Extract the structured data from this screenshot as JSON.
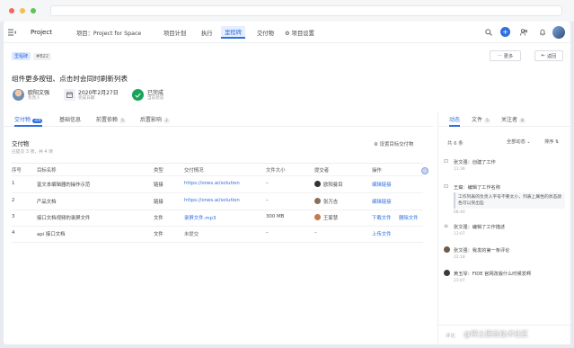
{
  "colors": {
    "accent": "#2f6fe0",
    "success": "#1aa35a"
  },
  "nav": {
    "menu_icon": "menu-collapse-icon",
    "project": "Project",
    "tabs": [
      "项目：Project for Space",
      "项目计划",
      "执行",
      "里程碑",
      "交付物",
      "项目设置"
    ],
    "active_tab": "里程碑"
  },
  "header": {
    "tag": "里程碑",
    "code": "#B22",
    "more": "更多",
    "back": "返回",
    "title": "组件更多按钮、点击时会同时刷新列表",
    "owner_name": "欧阳文强",
    "owner_label": "负责人",
    "date": "2020年2月27日",
    "date_label": "完成日期",
    "status": "已完成",
    "status_label": "当前状态"
  },
  "tabs": [
    {
      "label": "交付物",
      "count": "3/4"
    },
    {
      "label": "基础信息",
      "count": ""
    },
    {
      "label": "前置依赖",
      "count": "5"
    },
    {
      "label": "后置影响",
      "count": "2"
    }
  ],
  "deliverables": {
    "title": "交付物",
    "subtitle": "已提交 3 项，共 4 项",
    "settings": "设置目标交付物",
    "columns": [
      "序号",
      "目标名称",
      "类型",
      "交付情况",
      "文件大小",
      "提交者",
      "操作"
    ],
    "rows": [
      {
        "no": "1",
        "name": "富文本编辑器的操作示范",
        "type": "链接",
        "delivery": "https://ones.ai/solution",
        "size": "–",
        "submitter": "欧阳曼目",
        "actions": [
          "编辑链接"
        ]
      },
      {
        "no": "2",
        "name": "产品文档",
        "type": "链接",
        "delivery": "https://ones.ai/solution",
        "size": "–",
        "submitter": "张万吉",
        "actions": [
          "编辑链接"
        ]
      },
      {
        "no": "3",
        "name": "接口文档视频的录屏文件",
        "type": "文件",
        "delivery": "录屏文件.mp3",
        "size": "300 MB",
        "submitter": "王家慧",
        "actions": [
          "下载文件",
          "删除文件"
        ]
      },
      {
        "no": "4",
        "name": "api 接口文档",
        "type": "文件",
        "delivery": "未提交",
        "size": "–",
        "submitter": "–",
        "actions": [
          "上传文件"
        ]
      }
    ]
  },
  "activity": {
    "tabs": [
      {
        "label": "动态",
        "count": ""
      },
      {
        "label": "文件",
        "count": "5"
      },
      {
        "label": "关注者",
        "count": "8"
      }
    ],
    "total": "共 6 条",
    "filter": "全部动态",
    "sort": "排序",
    "items": [
      {
        "text": "张文强：创建了工作",
        "time": "11:36"
      },
      {
        "text": "王裔：编辑了工作名称",
        "detail": "工作列表的负责人字号不要太小，列表上属性的状态颜色可以突出些",
        "time": "08:40"
      },
      {
        "text": "张文强：编辑了工作描述",
        "time": "13:07"
      },
      {
        "text": "张文强：我发的第一条评论",
        "time": "22:18"
      },
      {
        "text": "黄玉琴：FIDE 官网改版什么时候发啊",
        "time": "23:07"
      }
    ],
    "comment_placeholder": "评论"
  },
  "watermark": "@稀土掘金技术社区"
}
